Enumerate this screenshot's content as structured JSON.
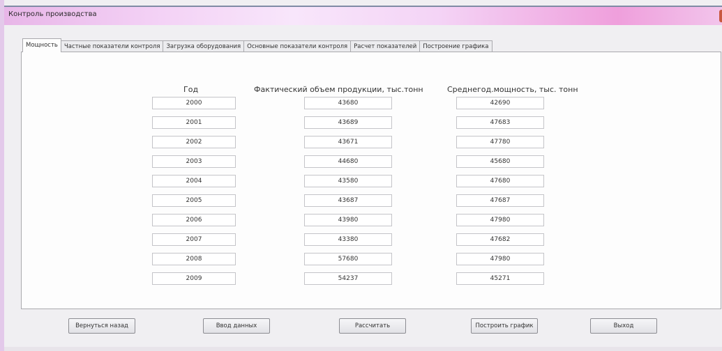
{
  "window": {
    "title": "Контроль производства"
  },
  "tabs": [
    {
      "label": "Мощность",
      "active": true
    },
    {
      "label": "Частные показатели контроля",
      "active": false
    },
    {
      "label": "Загрузка оборудования",
      "active": false
    },
    {
      "label": "Основные показатели контроля",
      "active": false
    },
    {
      "label": "Расчет показателей",
      "active": false
    },
    {
      "label": "Построение графика",
      "active": false
    }
  ],
  "table": {
    "headers": {
      "year": "Год",
      "actual_volume": "Фактический объем продукции, тыс.тонн",
      "avg_capacity": "Среднегод.мощность, тыс. тонн"
    },
    "rows": [
      {
        "year": "2000",
        "actual_volume": "43680",
        "avg_capacity": "42690"
      },
      {
        "year": "2001",
        "actual_volume": "43689",
        "avg_capacity": "47683"
      },
      {
        "year": "2002",
        "actual_volume": "43671",
        "avg_capacity": "47780"
      },
      {
        "year": "2003",
        "actual_volume": "44680",
        "avg_capacity": "45680"
      },
      {
        "year": "2004",
        "actual_volume": "43580",
        "avg_capacity": "47680"
      },
      {
        "year": "2005",
        "actual_volume": "43687",
        "avg_capacity": "47687"
      },
      {
        "year": "2006",
        "actual_volume": "43980",
        "avg_capacity": "47980"
      },
      {
        "year": "2007",
        "actual_volume": "43380",
        "avg_capacity": "47682"
      },
      {
        "year": "2008",
        "actual_volume": "57680",
        "avg_capacity": "47980"
      },
      {
        "year": "2009",
        "actual_volume": "54237",
        "avg_capacity": "45271"
      }
    ]
  },
  "buttons": {
    "back": "Вернуться назад",
    "input": "Ввод данных",
    "calculate": "Рассчитать",
    "plot": "Построить график",
    "exit": "Выход"
  }
}
